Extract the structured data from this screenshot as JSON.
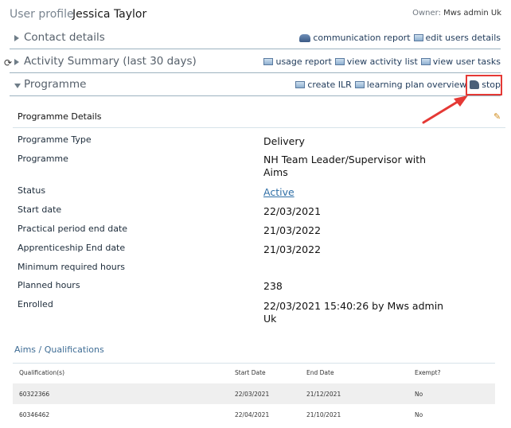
{
  "header": {
    "label": "User profile",
    "name": "Jessica Taylor",
    "owner_label": "Owner:",
    "owner_value": "Mws admin Uk"
  },
  "sections": {
    "contact": {
      "label": "Contact details",
      "links": [
        "communication report",
        "edit users details"
      ]
    },
    "activity": {
      "label": "Activity Summary (last 30 days)",
      "links": [
        "usage report",
        "view activity list",
        "view user tasks"
      ]
    },
    "programme": {
      "label": "Programme",
      "links": [
        "create ILR",
        "learning plan overview",
        "stop"
      ]
    }
  },
  "programme_details": {
    "heading": "Programme Details",
    "fields": [
      {
        "label": "Programme Type",
        "value": "Delivery"
      },
      {
        "label": "Programme",
        "value": "NH Team Leader/Supervisor with Aims"
      },
      {
        "label": "Status",
        "value": "Active"
      },
      {
        "label": "Start date",
        "value": "22/03/2021"
      },
      {
        "label": "Practical period end date",
        "value": "21/03/2022"
      },
      {
        "label": "Apprenticeship End date",
        "value": "21/03/2022"
      },
      {
        "label": "Minimum required hours",
        "value": ""
      },
      {
        "label": "Planned hours",
        "value": "238"
      },
      {
        "label": "Enrolled",
        "value": "22/03/2021 15:40:26 by Mws admin Uk"
      }
    ]
  },
  "aims": {
    "title": "Aims / Qualifications",
    "columns": [
      "Qualification(s)",
      "Start Date",
      "End Date",
      "Exempt?"
    ],
    "rows": [
      [
        "60322366",
        "22/03/2021",
        "21/12/2021",
        "No"
      ],
      [
        "60346462",
        "22/04/2021",
        "21/10/2021",
        "No"
      ]
    ]
  },
  "colors": {
    "highlight": "#e53935",
    "link": "#1f3a5a",
    "status_link": "#2f6fa6"
  }
}
